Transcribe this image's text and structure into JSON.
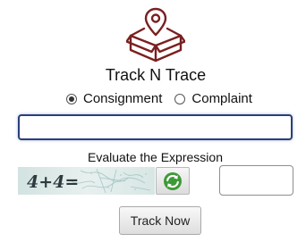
{
  "header": {
    "logo_icon": "package-location-pin-icon",
    "title": "Track N Trace"
  },
  "tracking_type": {
    "options": [
      {
        "label": "Consignment",
        "selected": true
      },
      {
        "label": "Complaint",
        "selected": false
      }
    ]
  },
  "tracking_input": {
    "value": "",
    "placeholder": ""
  },
  "captcha": {
    "label": "Evaluate the Expression",
    "expression": "4+4=",
    "refresh_icon": "refresh-arrows-icon",
    "answer_value": ""
  },
  "actions": {
    "track_label": "Track Now"
  },
  "colors": {
    "logo": "#7a1f1f",
    "input_border": "#2a3f7a",
    "refresh_green": "#3e9a36",
    "captcha_bg": "#dbe9e7"
  }
}
